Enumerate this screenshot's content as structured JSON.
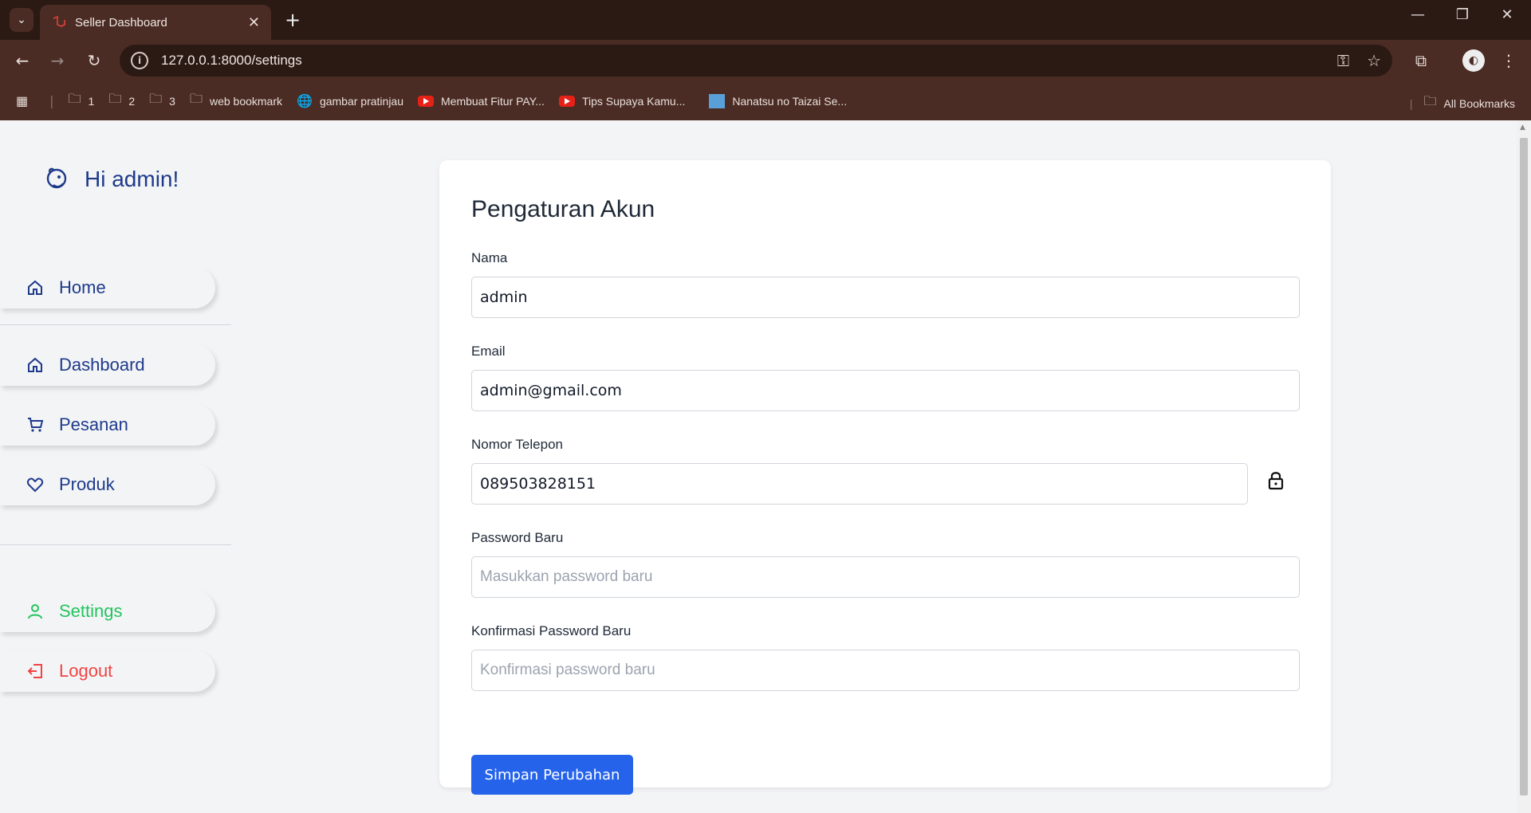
{
  "browser": {
    "tab_title": "Seller Dashboard",
    "url": "127.0.0.1:8000/settings",
    "bookmarks": [
      {
        "label": "1",
        "icon": "folder-icon"
      },
      {
        "label": "2",
        "icon": "folder-icon"
      },
      {
        "label": "3",
        "icon": "folder-icon"
      },
      {
        "label": "web bookmark",
        "icon": "folder-icon"
      },
      {
        "label": "gambar pratinjau",
        "icon": "globe-icon"
      },
      {
        "label": "Membuat Fitur PAY...",
        "icon": "youtube-icon"
      },
      {
        "label": "Tips Supaya Kamu...",
        "icon": "youtube-icon"
      },
      {
        "label": "Nanatsu no Taizai Se...",
        "icon": "image-icon"
      }
    ],
    "all_bookmarks": "All Bookmarks"
  },
  "sidebar": {
    "greeting": "Hi admin!",
    "items": [
      {
        "label": "Home",
        "icon": "home-icon"
      },
      {
        "label": "Dashboard",
        "icon": "home-icon"
      },
      {
        "label": "Pesanan",
        "icon": "cart-icon"
      },
      {
        "label": "Produk",
        "icon": "heart-icon"
      },
      {
        "label": "Settings",
        "icon": "user-icon"
      },
      {
        "label": "Logout",
        "icon": "logout-icon"
      }
    ]
  },
  "form": {
    "title": "Pengaturan Akun",
    "nama_label": "Nama",
    "nama_value": "admin",
    "email_label": "Email",
    "email_value": "admin@gmail.com",
    "phone_label": "Nomor Telepon",
    "phone_value": "089503828151",
    "password_label": "Password Baru",
    "password_placeholder": "Masukkan password baru",
    "confirm_label": "Konfirmasi Password Baru",
    "confirm_placeholder": "Konfirmasi password baru",
    "submit_label": "Simpan Perubahan"
  },
  "colors": {
    "primary_button": "#2563eb",
    "sidebar_text": "#1e3a8a",
    "active_item": "#22c55e",
    "logout": "#ef4444"
  }
}
